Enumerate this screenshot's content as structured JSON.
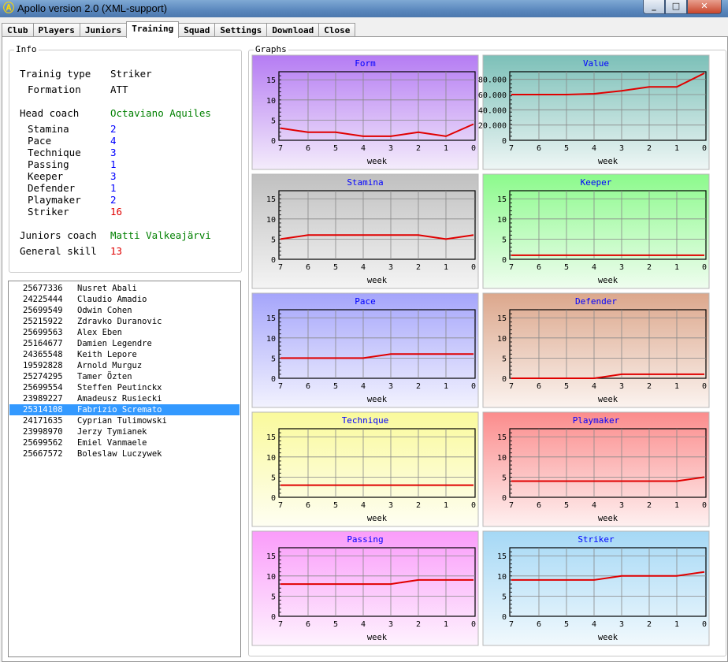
{
  "window": {
    "title": "Apollo version 2.0 (XML-support)",
    "icon": "app-logo-icon",
    "controls": [
      "minimize-icon",
      "maximize-icon",
      "close-icon"
    ]
  },
  "tabs": [
    "Club",
    "Players",
    "Juniors",
    "Training",
    "Squad",
    "Settings",
    "Download",
    "Close"
  ],
  "active_tab": "Training",
  "info": {
    "legend": "Info",
    "training_type_label": "Trainig type",
    "training_type": "Striker",
    "formation_label": "Formation",
    "formation": "ATT",
    "head_coach_label": "Head coach",
    "head_coach": "Octaviano Aquiles",
    "skills": [
      {
        "label": "Stamina",
        "value": "2",
        "color": "#0000ff"
      },
      {
        "label": "Pace",
        "value": "4",
        "color": "#0000ff"
      },
      {
        "label": "Technique",
        "value": "3",
        "color": "#0000ff"
      },
      {
        "label": "Passing",
        "value": "1",
        "color": "#0000ff"
      },
      {
        "label": "Keeper",
        "value": "3",
        "color": "#0000ff"
      },
      {
        "label": "Defender",
        "value": "1",
        "color": "#0000ff"
      },
      {
        "label": "Playmaker",
        "value": "2",
        "color": "#0000ff"
      },
      {
        "label": "Striker",
        "value": "16",
        "color": "#e00000"
      }
    ],
    "juniors_coach_label": "Juniors coach",
    "juniors_coach": "Matti Valkeajärvi",
    "general_skill_label": "General skill",
    "general_skill": "13"
  },
  "players": [
    {
      "id": "25677336",
      "name": "Nusret Abali"
    },
    {
      "id": "24225444",
      "name": "Claudio Amadio"
    },
    {
      "id": "25699549",
      "name": "Odwin Cohen"
    },
    {
      "id": "25215922",
      "name": "Zdravko Duranovic"
    },
    {
      "id": "25699563",
      "name": "Alex Eben"
    },
    {
      "id": "25164677",
      "name": "Damien Legendre"
    },
    {
      "id": "24365548",
      "name": "Keith Lepore"
    },
    {
      "id": "19592828",
      "name": "Arnold Murguz"
    },
    {
      "id": "25274295",
      "name": "Tamer Özten"
    },
    {
      "id": "25699554",
      "name": "Steffen Peutinckx"
    },
    {
      "id": "23989227",
      "name": "Amadeusz Rusiecki"
    },
    {
      "id": "25314108",
      "name": "Fabrizio Scremato",
      "selected": true
    },
    {
      "id": "24171635",
      "name": "Cyprian Tulimowski"
    },
    {
      "id": "23998970",
      "name": "Jerzy Tymianek"
    },
    {
      "id": "25699562",
      "name": "Emiel Vanmaele"
    },
    {
      "id": "25667572",
      "name": "Boleslaw Luczywek"
    }
  ],
  "graphs_legend": "Graphs",
  "chart_data": [
    {
      "type": "line",
      "title": "Form",
      "xlabel": "week",
      "x": [
        7,
        6,
        5,
        4,
        3,
        2,
        1,
        0
      ],
      "ylim": [
        0,
        17
      ],
      "yticks": [
        "0",
        "5",
        "10",
        "15"
      ],
      "ytickvals": [
        0,
        5,
        10,
        15
      ],
      "values": [
        3,
        2,
        2,
        1,
        1,
        2,
        1,
        4
      ],
      "bg_top": "#b57cf3",
      "bg_bottom": "#f4ecfb",
      "grid": true
    },
    {
      "type": "line",
      "title": "Value",
      "xlabel": "week",
      "x": [
        7,
        6,
        5,
        4,
        3,
        2,
        1,
        0
      ],
      "ylim": [
        0,
        90000
      ],
      "yticks": [
        "0",
        "20.000",
        "40.000",
        "60.000",
        "80.000"
      ],
      "ytickvals": [
        0,
        20000,
        40000,
        60000,
        80000
      ],
      "values": [
        60000,
        60000,
        60000,
        61000,
        65000,
        70000,
        70000,
        88000
      ],
      "bg_top": "#7cc0b8",
      "bg_bottom": "#eef6f5",
      "grid": true
    },
    {
      "type": "line",
      "title": "Stamina",
      "xlabel": "week",
      "x": [
        7,
        6,
        5,
        4,
        3,
        2,
        1,
        0
      ],
      "ylim": [
        0,
        17
      ],
      "yticks": [
        "0",
        "5",
        "10",
        "15"
      ],
      "ytickvals": [
        0,
        5,
        10,
        15
      ],
      "values": [
        5,
        6,
        6,
        6,
        6,
        6,
        5,
        6
      ],
      "bg_top": "#c0c0c0",
      "bg_bottom": "#f4f4f4",
      "grid": true
    },
    {
      "type": "line",
      "title": "Keeper",
      "xlabel": "week",
      "x": [
        7,
        6,
        5,
        4,
        3,
        2,
        1,
        0
      ],
      "ylim": [
        0,
        17
      ],
      "yticks": [
        "0",
        "5",
        "10",
        "15"
      ],
      "ytickvals": [
        0,
        5,
        10,
        15
      ],
      "values": [
        1,
        1,
        1,
        1,
        1,
        1,
        1,
        1
      ],
      "bg_top": "#8cfa8c",
      "bg_bottom": "#effdef",
      "grid": true
    },
    {
      "type": "line",
      "title": "Pace",
      "xlabel": "week",
      "x": [
        7,
        6,
        5,
        4,
        3,
        2,
        1,
        0
      ],
      "ylim": [
        0,
        17
      ],
      "yticks": [
        "0",
        "5",
        "10",
        "15"
      ],
      "ytickvals": [
        0,
        5,
        10,
        15
      ],
      "values": [
        5,
        5,
        5,
        5,
        6,
        6,
        6,
        6
      ],
      "bg_top": "#a5a5fb",
      "bg_bottom": "#f2f2fe",
      "grid": true
    },
    {
      "type": "line",
      "title": "Defender",
      "xlabel": "week",
      "x": [
        7,
        6,
        5,
        4,
        3,
        2,
        1,
        0
      ],
      "ylim": [
        0,
        17
      ],
      "yticks": [
        "0",
        "5",
        "10",
        "15"
      ],
      "ytickvals": [
        0,
        5,
        10,
        15
      ],
      "values": [
        0,
        0,
        0,
        0,
        1,
        1,
        1,
        1
      ],
      "bg_top": "#dca78c",
      "bg_bottom": "#fbf3ef",
      "grid": true
    },
    {
      "type": "line",
      "title": "Technique",
      "xlabel": "week",
      "x": [
        7,
        6,
        5,
        4,
        3,
        2,
        1,
        0
      ],
      "ylim": [
        0,
        17
      ],
      "yticks": [
        "0",
        "5",
        "10",
        "15"
      ],
      "ytickvals": [
        0,
        5,
        10,
        15
      ],
      "values": [
        3,
        3,
        3,
        3,
        3,
        3,
        3,
        3
      ],
      "bg_top": "#fafa9c",
      "bg_bottom": "#fefef2",
      "grid": true
    },
    {
      "type": "line",
      "title": "Playmaker",
      "xlabel": "week",
      "x": [
        7,
        6,
        5,
        4,
        3,
        2,
        1,
        0
      ],
      "ylim": [
        0,
        17
      ],
      "yticks": [
        "0",
        "5",
        "10",
        "15"
      ],
      "ytickvals": [
        0,
        5,
        10,
        15
      ],
      "values": [
        4,
        4,
        4,
        4,
        4,
        4,
        4,
        5
      ],
      "bg_top": "#fb8c8c",
      "bg_bottom": "#fef0f0",
      "grid": true
    },
    {
      "type": "line",
      "title": "Passing",
      "xlabel": "week",
      "x": [
        7,
        6,
        5,
        4,
        3,
        2,
        1,
        0
      ],
      "ylim": [
        0,
        17
      ],
      "yticks": [
        "0",
        "5",
        "10",
        "15"
      ],
      "ytickvals": [
        0,
        5,
        10,
        15
      ],
      "values": [
        8,
        8,
        8,
        8,
        8,
        9,
        9,
        9
      ],
      "bg_top": "#fa9cfa",
      "bg_bottom": "#fef2fe",
      "grid": true
    },
    {
      "type": "line",
      "title": "Striker",
      "xlabel": "week",
      "x": [
        7,
        6,
        5,
        4,
        3,
        2,
        1,
        0
      ],
      "ylim": [
        0,
        17
      ],
      "yticks": [
        "0",
        "5",
        "10",
        "15"
      ],
      "ytickvals": [
        0,
        5,
        10,
        15
      ],
      "values": [
        9,
        9,
        9,
        9,
        10,
        10,
        10,
        11
      ],
      "bg_top": "#a5d8f5",
      "bg_bottom": "#f1f9fd",
      "grid": true
    }
  ],
  "colors": {
    "line": "#e00000",
    "title_text": "#0000ff",
    "selection": "#3399ff"
  }
}
